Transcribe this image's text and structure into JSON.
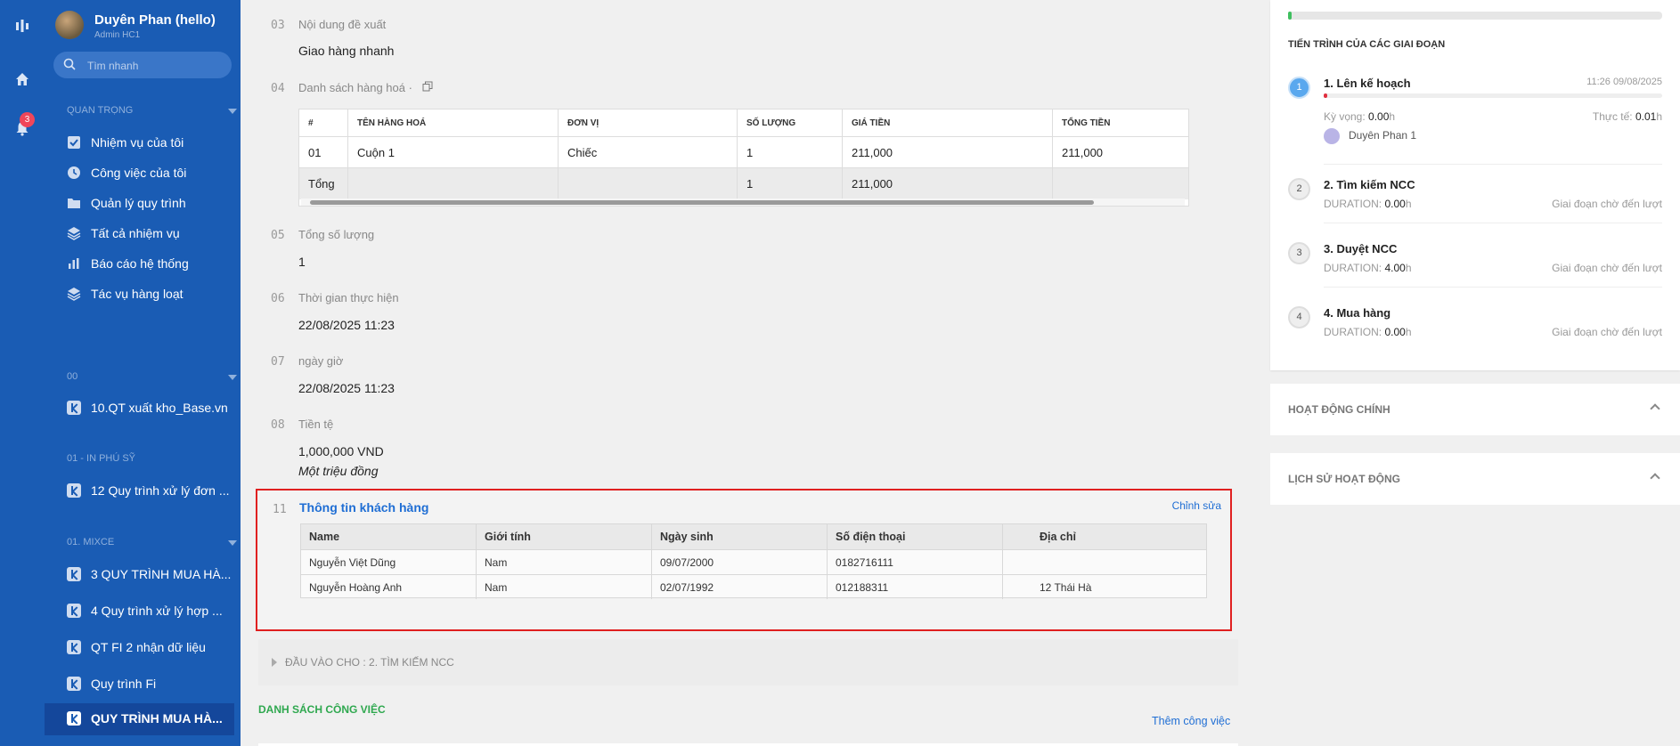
{
  "sidebar": {
    "user": {
      "name": "Duyên Phan (hello)",
      "role": "Admin HC1"
    },
    "search_placeholder": "Tìm nhanh",
    "notification_count": "3",
    "sections": [
      {
        "title": "QUAN TRỌNG",
        "items": [
          "Nhiệm vụ của tôi",
          "Công việc của tôi",
          "Quản lý quy trình",
          "Tất cả nhiệm vụ",
          "Báo cáo hệ thống",
          "Tác vụ hàng loạt"
        ]
      },
      {
        "title": "00",
        "items": [
          "10.QT xuất kho_Base.vn"
        ]
      },
      {
        "title": "01 - IN PHÚ SỸ",
        "items": [
          "12 Quy trình xử lý đơn ..."
        ]
      },
      {
        "title": "01. MIXCE",
        "items": [
          "3 QUY TRÌNH MUA HÀ...",
          "4 Quy trình xử lý hợp ...",
          "QT FI 2 nhận dữ liệu",
          "Quy trình Fi",
          "QUY TRÌNH MUA HÀ..."
        ]
      }
    ]
  },
  "fields": [
    {
      "num": "03",
      "label": "Nội dung đề xuất",
      "value": "Giao hàng nhanh"
    },
    {
      "num": "04",
      "label": "Danh sách hàng hoá ·"
    },
    {
      "num": "05",
      "label": "Tổng số lượng",
      "value": "1"
    },
    {
      "num": "06",
      "label": "Thời gian thực hiện",
      "value": "22/08/2025 11:23"
    },
    {
      "num": "07",
      "label": "ngày giờ",
      "value": "22/08/2025 11:23"
    },
    {
      "num": "08",
      "label": "Tiền tệ",
      "value": "1,000,000 VND",
      "sub": "Một triệu đồng"
    }
  ],
  "goods_table": {
    "headers": [
      "#",
      "TÊN HÀNG HOÁ",
      "ĐƠN VỊ",
      "SỐ LƯỢNG",
      "GIÁ TIỀN",
      "TỔNG TIỀN"
    ],
    "rows": [
      [
        "01",
        "Cuộn 1",
        "Chiếc",
        "1",
        "211,000",
        "211,000"
      ]
    ],
    "total": [
      "Tổng",
      "",
      "",
      "1",
      "211,000",
      ""
    ]
  },
  "customer": {
    "num": "11",
    "title": "Thông tin khách hàng",
    "edit": "Chỉnh sửa",
    "headers": [
      "Name",
      "Giới tính",
      "Ngày sinh",
      "Số điện thoại",
      "Địa chỉ"
    ],
    "rows": [
      [
        "Nguyễn Việt Dũng",
        "Nam",
        "09/07/2000",
        "0182716111",
        ""
      ],
      [
        "Nguyễn Hoàng Anh",
        "Nam",
        "02/07/1992",
        "012188311",
        "12 Thái Hà"
      ]
    ]
  },
  "input_for": "ĐẦU VÀO CHO : 2. TÌM KIẾM NCC",
  "tasks": {
    "title": "DANH SÁCH CÔNG VIỆC",
    "add": "Thêm công việc"
  },
  "progress": {
    "overall_fraction": 0.01,
    "title": "TIẾN TRÌNH CỦA CÁC GIAI ĐOẠN",
    "stages": [
      {
        "no": "1",
        "name": "1. Lên kế hoạch",
        "time": "11:26 09/08/2025",
        "expect_label": "Kỳ vọng: ",
        "expect": "0.00",
        "unit": "h",
        "actual_label": "Thực tế: ",
        "actual": "0.01",
        "assignee": "Duyên Phan 1",
        "progress_fraction": 0.01
      },
      {
        "no": "2",
        "name": "2. Tìm kiếm NCC",
        "duration_label": "DURATION: ",
        "duration": "0.00",
        "unit": "h",
        "status": "Giai đoạn chờ đến lượt"
      },
      {
        "no": "3",
        "name": "3. Duyệt NCC",
        "duration_label": "DURATION: ",
        "duration": "4.00",
        "unit": "h",
        "status": "Giai đoạn chờ đến lượt"
      },
      {
        "no": "4",
        "name": "4. Mua hàng",
        "duration_label": "DURATION: ",
        "duration": "0.00",
        "unit": "h",
        "status": "Giai đoạn chờ đến lượt"
      }
    ]
  },
  "panels": {
    "main_activity": "HOẠT ĐỘNG CHÍNH",
    "history": "LỊCH SỬ HOẠT ĐỘNG"
  }
}
